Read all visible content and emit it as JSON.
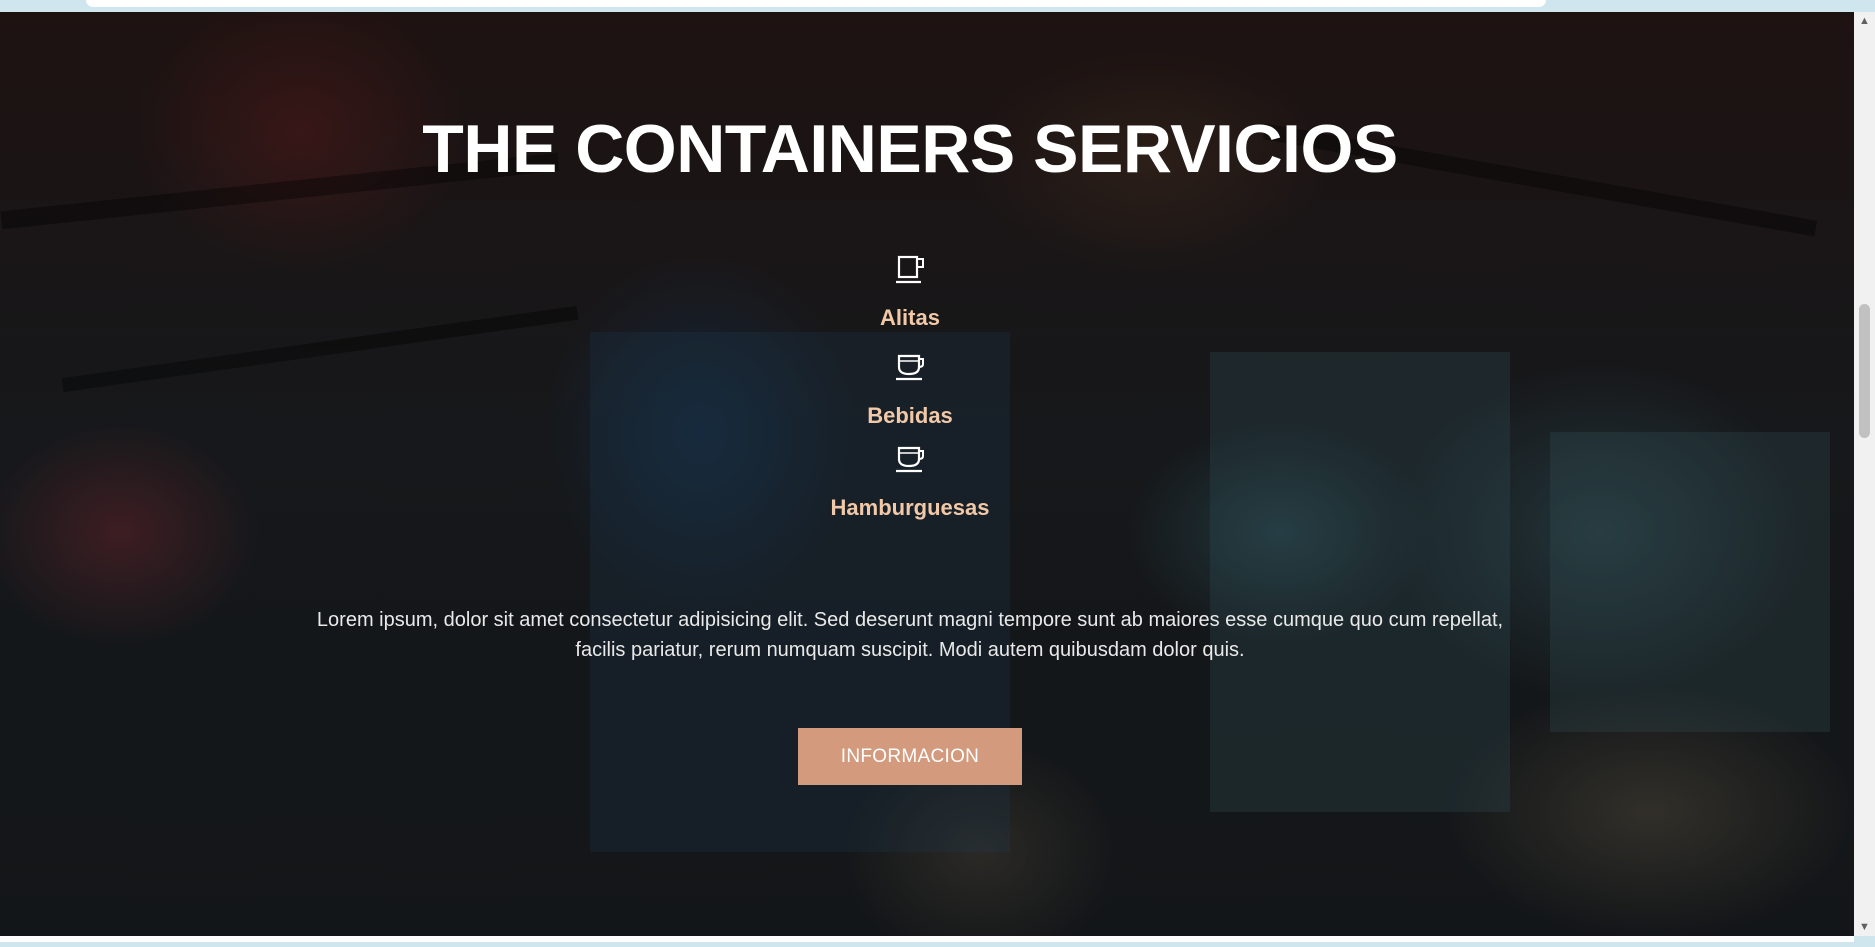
{
  "hero": {
    "title": "THE CONTAINERS SERVICIOS",
    "services": [
      {
        "label": "Alitas",
        "icon": "coffee-mug-icon"
      },
      {
        "label": "Bebidas",
        "icon": "coffee-cup-icon"
      },
      {
        "label": "Hamburguesas",
        "icon": "coffee-cup-icon"
      }
    ],
    "description": "Lorem ipsum, dolor sit amet consectetur adipisicing elit. Sed deserunt magni tempore sunt ab maiores esse cumque quo cum repellat, facilis pariatur, rerum numquam suscipit. Modi autem quibusdam dolor quis.",
    "button_label": "INFORMACION"
  },
  "colors": {
    "accent": "#d49a7e",
    "service_label": "#f2c9a8",
    "title": "#ffffff"
  },
  "scrollbar": {
    "up_icon": "scroll-up-arrow-icon",
    "down_icon": "scroll-down-arrow-icon"
  }
}
